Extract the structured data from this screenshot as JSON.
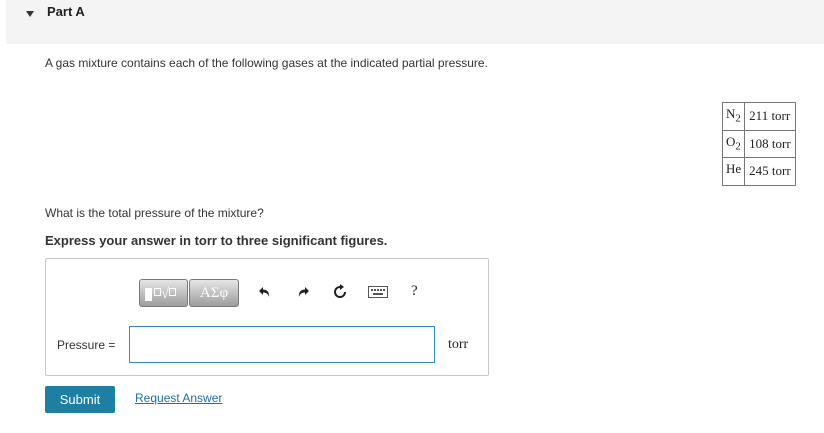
{
  "part": {
    "title": "Part A"
  },
  "problem": {
    "intro": "A gas mixture contains each of the following gases at the indicated partial pressure.",
    "gases": [
      {
        "symbol": "N",
        "subscript": "2",
        "pressure": "211 torr"
      },
      {
        "symbol": "O",
        "subscript": "2",
        "pressure": "108 torr"
      },
      {
        "symbol": "He",
        "subscript": "",
        "pressure": "245 torr"
      }
    ],
    "question": "What is the total pressure of the mixture?",
    "instruction": "Express your answer in torr to three significant figures."
  },
  "toolbar": {
    "templates_icon": "templates-icon",
    "greek_label": "ΑΣφ",
    "undo_icon": "undo-icon",
    "redo_icon": "redo-icon",
    "reset_icon": "reset-icon",
    "keyboard_icon": "keyboard-icon",
    "help_label": "?"
  },
  "answer": {
    "label": "Pressure =",
    "value": "",
    "unit": "torr"
  },
  "actions": {
    "submit_label": "Submit",
    "request_label": "Request Answer"
  },
  "colors": {
    "submit_bg": "#1f7fa3",
    "link": "#1f6fa8",
    "input_border": "#2f8ebf"
  }
}
